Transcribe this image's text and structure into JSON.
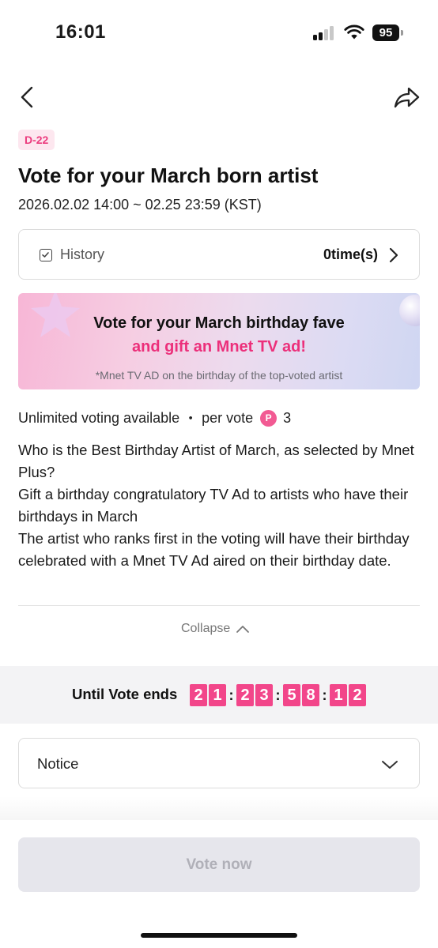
{
  "status_bar": {
    "time": "16:01",
    "battery": "95",
    "icons": [
      "signal-icon",
      "wifi-icon",
      "battery-icon"
    ]
  },
  "header": {
    "back_icon": "chevron-left-icon",
    "share_icon": "share-arrow-icon"
  },
  "vote": {
    "dday": "D-22",
    "title": "Vote for your March born artist",
    "date_range": "2026.02.02 14:00 ~ 02.25 23:59 (KST)"
  },
  "history": {
    "label": "History",
    "count": "0time(s)"
  },
  "banner": {
    "line1": "Vote for your March birthday fave",
    "line2": "and gift an Mnet TV ad!",
    "note": "*Mnet TV AD on the birthday of the top-voted artist",
    "highlight_color": "#ec2f7a"
  },
  "voting_info": {
    "unlimited": "Unlimited voting available",
    "separator": "・",
    "per_vote": "per vote",
    "point_icon_letter": "P",
    "cost": "3"
  },
  "description": [
    "Who is the Best Birthday Artist of March, as selected by Mnet Plus?",
    "Gift a birthday congratulatory TV Ad to artists who have their birthdays in March",
    "The artist who ranks first in the voting will have their birthday celebrated with a Mnet TV Ad aired on their birthday date."
  ],
  "collapse_label": "Collapse",
  "countdown": {
    "label": "Until Vote ends",
    "digits": [
      "2",
      "1",
      "2",
      "3",
      "5",
      "8",
      "1",
      "2"
    ],
    "separator": ":",
    "accent_color": "#f2468a"
  },
  "notice": {
    "label": "Notice"
  },
  "vote_button": {
    "label": "Vote now"
  }
}
